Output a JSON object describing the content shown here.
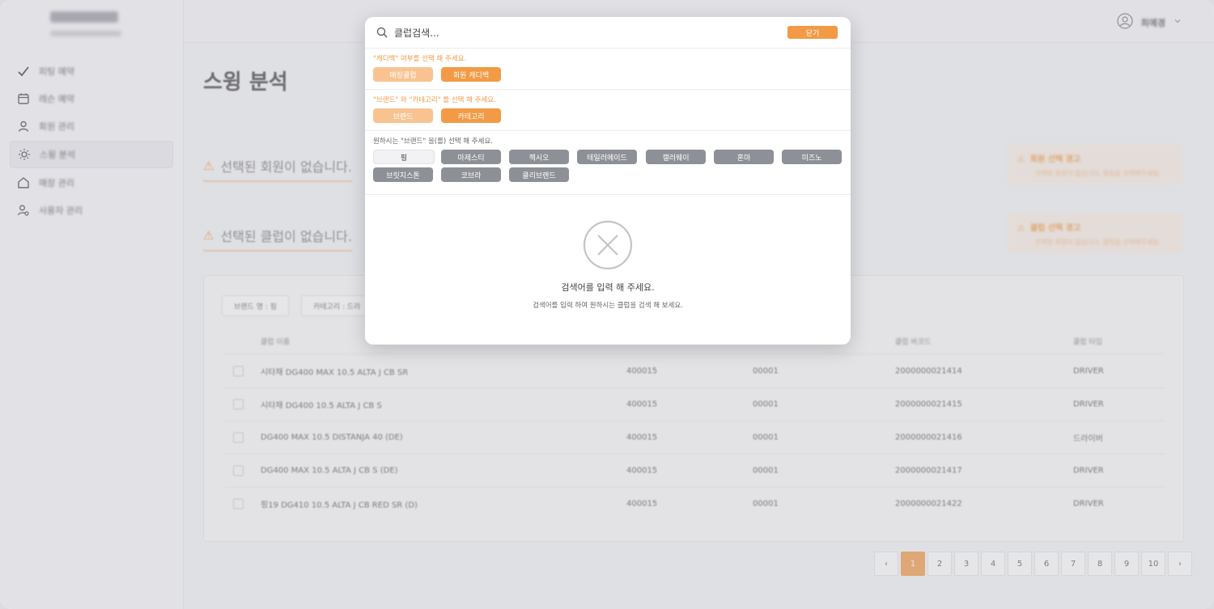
{
  "sidebar": {
    "items": [
      {
        "label": "피팅 예약",
        "icon": "check-icon"
      },
      {
        "label": "레슨 예약",
        "icon": "calendar-icon"
      },
      {
        "label": "회원 관리",
        "icon": "user-icon"
      },
      {
        "label": "스윙 분석",
        "icon": "sun-icon",
        "active": true
      },
      {
        "label": "매장 관리",
        "icon": "home-icon"
      },
      {
        "label": "사용자 관리",
        "icon": "user-settings-icon"
      }
    ]
  },
  "header": {
    "user_name": "최예경"
  },
  "main": {
    "title": "스윙 분석",
    "warn_member": "선택된 회원이 없습니다.",
    "warn_club": "선택된 클럽이 없습니다.",
    "warn_box_member": {
      "title": "회원 선택 경고",
      "desc": "선택된 회원이 없습니다. 회원을 선택해주세요."
    },
    "warn_box_club": {
      "title": "클럽 선택 경고",
      "desc": "선택된 회원이 없습니다. 클럽을 선택해주세요."
    },
    "filter_brand": "브랜드 명 : 핑",
    "filter_category": "카테고리 : 드라",
    "table": {
      "headers": [
        "클럽 이름",
        "클럽 바코드",
        "클럽 타입"
      ],
      "rows": [
        {
          "name": "시타채 DG400 MAX 10.5 ALTA J CB SR",
          "code1": "400015",
          "code2": "00001",
          "barcode": "2000000021414",
          "type": "DRIVER"
        },
        {
          "name": "시타채 DG400 10.5 ALTA J CB S",
          "code1": "400015",
          "code2": "00001",
          "barcode": "2000000021415",
          "type": "DRIVER"
        },
        {
          "name": "DG400 MAX 10.5 DISTANJA 40 (DE)",
          "code1": "400015",
          "code2": "00001",
          "barcode": "2000000021416",
          "type": "드라이버"
        },
        {
          "name": "DG400 MAX 10.5 ALTA J CB S (DE)",
          "code1": "400015",
          "code2": "00001",
          "barcode": "2000000021417",
          "type": "DRIVER"
        },
        {
          "name": "핑19 DG410 10.5 ALTA J CB RED SR (D)",
          "code1": "400015",
          "code2": "00001",
          "barcode": "2000000021422",
          "type": "DRIVER"
        }
      ]
    },
    "pagination": {
      "prev": "‹",
      "next": "›",
      "pages": [
        "1",
        "2",
        "3",
        "4",
        "5",
        "6",
        "7",
        "8",
        "9",
        "10"
      ],
      "current": "1"
    }
  },
  "modal": {
    "search_placeholder": "클럽검색...",
    "close_label": "닫기",
    "caddie_prompt": "\"캐디백\" 여부를 선택 해 주세요.",
    "store_club": "매장클럽",
    "member_caddie": "회원 캐디백",
    "mode_prompt": "\"브랜드\" 와 \"카테고리\" 를 선택 해 주세요.",
    "brand_label": "브랜드",
    "category_label": "카테고리",
    "brand_prompt": "원하시는 \"브랜드\" 을(를) 선택 해 주세요.",
    "brands": [
      "핑",
      "마제스티",
      "젝시오",
      "테일러메이드",
      "캘러웨이",
      "혼마",
      "미즈노",
      "브릿지스톤",
      "코브라",
      "클리브랜드"
    ],
    "empty_title": "검색어를 입력 해 주세요.",
    "empty_desc": "검색어를 입력 하여 원하시는 클럽을 검색 해 보세요."
  }
}
